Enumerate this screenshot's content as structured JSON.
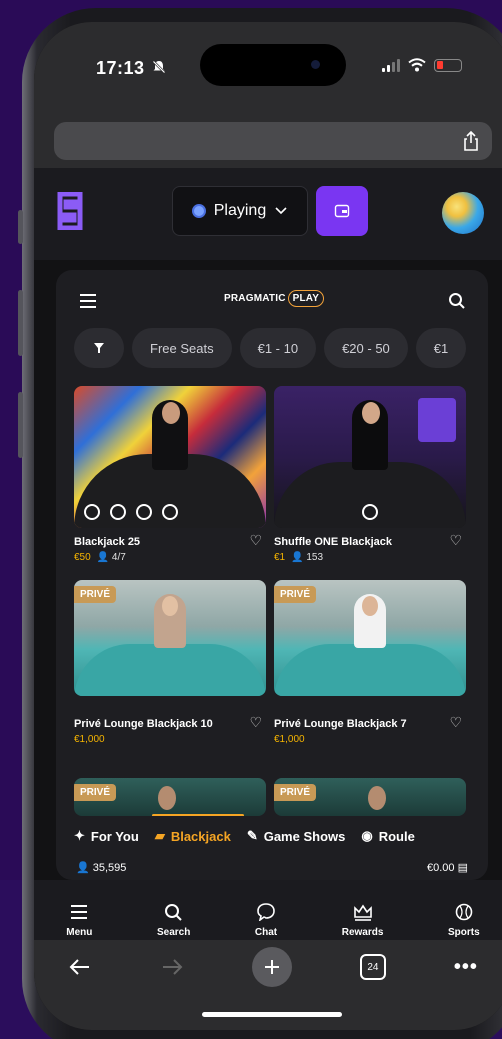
{
  "status": {
    "time": "17:13"
  },
  "header": {
    "playing_label": "Playing"
  },
  "provider": {
    "name": "PRAGMATIC",
    "play": "PLAY"
  },
  "filters": [
    "Free Seats",
    "€1 - 10",
    "€20 - 50",
    "€1"
  ],
  "games": [
    {
      "name": "Blackjack 25",
      "bet": "€50",
      "seats": "4/7"
    },
    {
      "name": "Shuffle ONE Blackjack",
      "bet": "€1",
      "seats": "153"
    },
    {
      "name": "Privé Lounge Blackjack 10",
      "bet": "€1,000",
      "badge": "PRIVÉ"
    },
    {
      "name": "Privé Lounge Blackjack 7",
      "bet": "€1,000",
      "badge": "PRIVÉ"
    },
    {
      "badge": "PRIVÉ"
    },
    {
      "badge": "PRIVÉ"
    }
  ],
  "categories": [
    "For You",
    "Blackjack",
    "Game Shows",
    "Roule"
  ],
  "footer_stats": {
    "players": "35,595",
    "balance": "€0.00"
  },
  "bottom_nav": [
    "Menu",
    "Search",
    "Chat",
    "Rewards",
    "Sports"
  ],
  "safari": {
    "tab_count": "24"
  },
  "colors": {
    "accent": "#7a36f2",
    "gold": "#f5a524",
    "bg": "#2a0b57"
  }
}
